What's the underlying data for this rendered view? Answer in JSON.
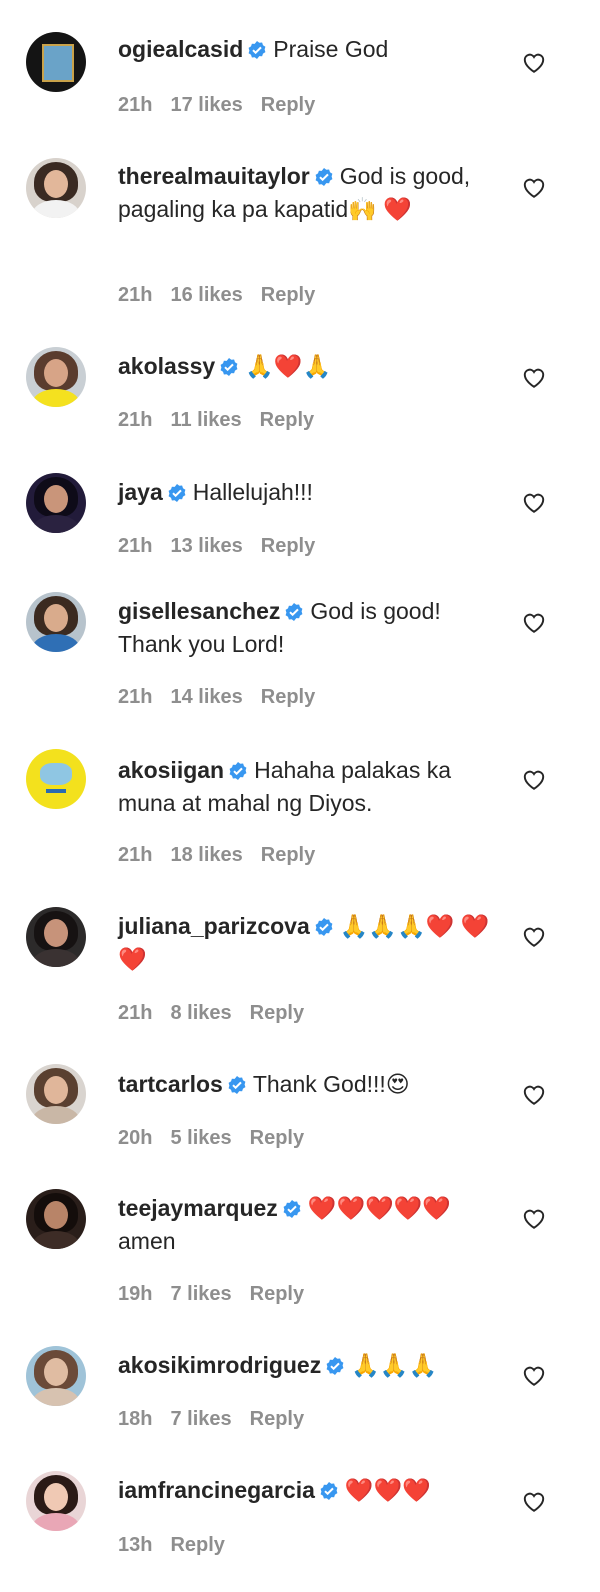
{
  "comments": [
    {
      "user": "ogiealcasid",
      "text": "Praise God",
      "time": "21h",
      "likes": "17 likes",
      "reply": "Reply"
    },
    {
      "user": "therealmauitaylor",
      "text": "God is good, pagaling ka pa kapatid🙌 ❤️",
      "time": "21h",
      "likes": "16 likes",
      "reply": "Reply"
    },
    {
      "user": "akolassy",
      "text": "🙏❤️🙏",
      "time": "21h",
      "likes": "11 likes",
      "reply": "Reply"
    },
    {
      "user": "jaya",
      "text": "Hallelujah!!!",
      "time": "21h",
      "likes": "13 likes",
      "reply": "Reply"
    },
    {
      "user": "gisellesanchez",
      "text": "God is good! Thank you Lord!",
      "time": "21h",
      "likes": "14 likes",
      "reply": "Reply"
    },
    {
      "user": "akosiigan",
      "text": "Hahaha palakas ka muna at mahal ng Diyos.",
      "time": "21h",
      "likes": "18 likes",
      "reply": "Reply"
    },
    {
      "user": "juliana_parizcova",
      "text": "🙏🙏🙏❤️ ❤️❤️",
      "time": "21h",
      "likes": "8 likes",
      "reply": "Reply"
    },
    {
      "user": "tartcarlos",
      "text": "Thank God!!!😍",
      "time": "20h",
      "likes": "5 likes",
      "reply": "Reply"
    },
    {
      "user": "teejaymarquez",
      "text": "❤️❤️❤️❤️❤️ amen",
      "time": "19h",
      "likes": "7 likes",
      "reply": "Reply"
    },
    {
      "user": "akosikimrodriguez",
      "text": "🙏🙏🙏",
      "time": "18h",
      "likes": "7 likes",
      "reply": "Reply"
    },
    {
      "user": "iamfrancinegarcia",
      "text": "❤️❤️❤️",
      "time": "13h",
      "likes": "",
      "reply": "Reply"
    }
  ],
  "colors": {
    "verified": "#3897f0",
    "muted": "#8e8e8e",
    "text": "#262626",
    "heart": "#e0162b"
  }
}
